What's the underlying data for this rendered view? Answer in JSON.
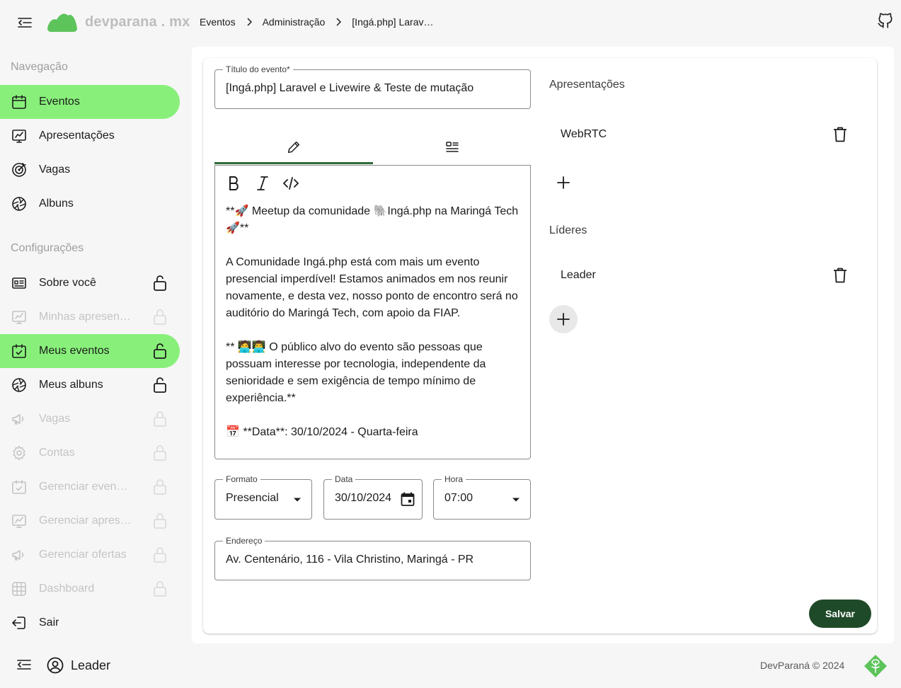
{
  "header": {
    "logo_text": "devparana . mx",
    "breadcrumb": [
      "Eventos",
      "Administração",
      "[Ingá.php] Larav…"
    ]
  },
  "sidebar": {
    "nav_title": "Navegação",
    "nav_items": [
      {
        "label": "Eventos",
        "icon": "calendar-icon",
        "active": true
      },
      {
        "label": "Apresentações",
        "icon": "presentation-icon"
      },
      {
        "label": "Vagas",
        "icon": "target-icon"
      },
      {
        "label": "Albuns",
        "icon": "aperture-icon"
      }
    ],
    "config_title": "Configurações",
    "config_items": [
      {
        "label": "Sobre você",
        "icon": "id-card-icon",
        "locked": true,
        "disabled": false
      },
      {
        "label": "Minhas apresentações",
        "icon": "presentation-icon",
        "locked": true,
        "disabled": true
      },
      {
        "label": "Meus eventos",
        "icon": "calendar-check-icon",
        "locked": true,
        "disabled": false,
        "active": true
      },
      {
        "label": "Meus albuns",
        "icon": "aperture-icon",
        "locked": true,
        "disabled": false
      },
      {
        "label": "Vagas",
        "icon": "megaphone-icon",
        "locked": true,
        "disabled": true
      },
      {
        "label": "Contas",
        "icon": "gear-icon",
        "locked": true,
        "disabled": true
      },
      {
        "label": "Gerenciar eventos",
        "icon": "calendar-check-icon",
        "locked": true,
        "disabled": true
      },
      {
        "label": "Gerenciar apresentações",
        "icon": "presentation-icon",
        "locked": true,
        "disabled": true
      },
      {
        "label": "Gerenciar ofertas",
        "icon": "megaphone-icon",
        "locked": true,
        "disabled": true
      },
      {
        "label": "Dashboard",
        "icon": "grid-icon",
        "locked": true,
        "disabled": true
      }
    ],
    "logout_label": "Sair"
  },
  "form": {
    "title_label": "Título do evento*",
    "title_value": "[Ingá.php] Laravel e Livewire & Teste de mutação",
    "description": "**🚀 Meetup da comunidade 🐘Ingá.php na Maringá Tech 🚀**\n\nA Comunidade Ingá.php está com mais um evento presencial imperdível! Estamos animados em nos reunir novamente, e desta vez, nosso ponto de encontro será no auditório do Maringá Tech, com apoio da FIAP.\n\n** 🧑‍💻👨‍💻 O público alvo do evento são pessoas que possuam interesse por tecnologia, independente da senioridade e sem exigência de tempo mínimo de experiência.**\n\n📅 **Data**: 30/10/2024 - Quarta-feira",
    "format_label": "Formato",
    "format_value": "Presencial",
    "date_label": "Data",
    "date_value": "30/10/2024",
    "time_label": "Hora",
    "time_value": "07:00",
    "address_label": "Endereço",
    "address_value": "Av. Centenário, 116 - Vila Christino, Maringá - PR",
    "save_label": "Salvar"
  },
  "presentations": {
    "title": "Apresentações",
    "items": [
      "WebRTC"
    ]
  },
  "leaders": {
    "title": "Líderes",
    "items": [
      "Leader"
    ]
  },
  "footer": {
    "user_name": "Leader",
    "copyright": "DevParaná © 2024"
  },
  "colors": {
    "active_nav": "#88f07a",
    "save_button": "#1f4a29",
    "logo_green": "#5cc45a"
  }
}
